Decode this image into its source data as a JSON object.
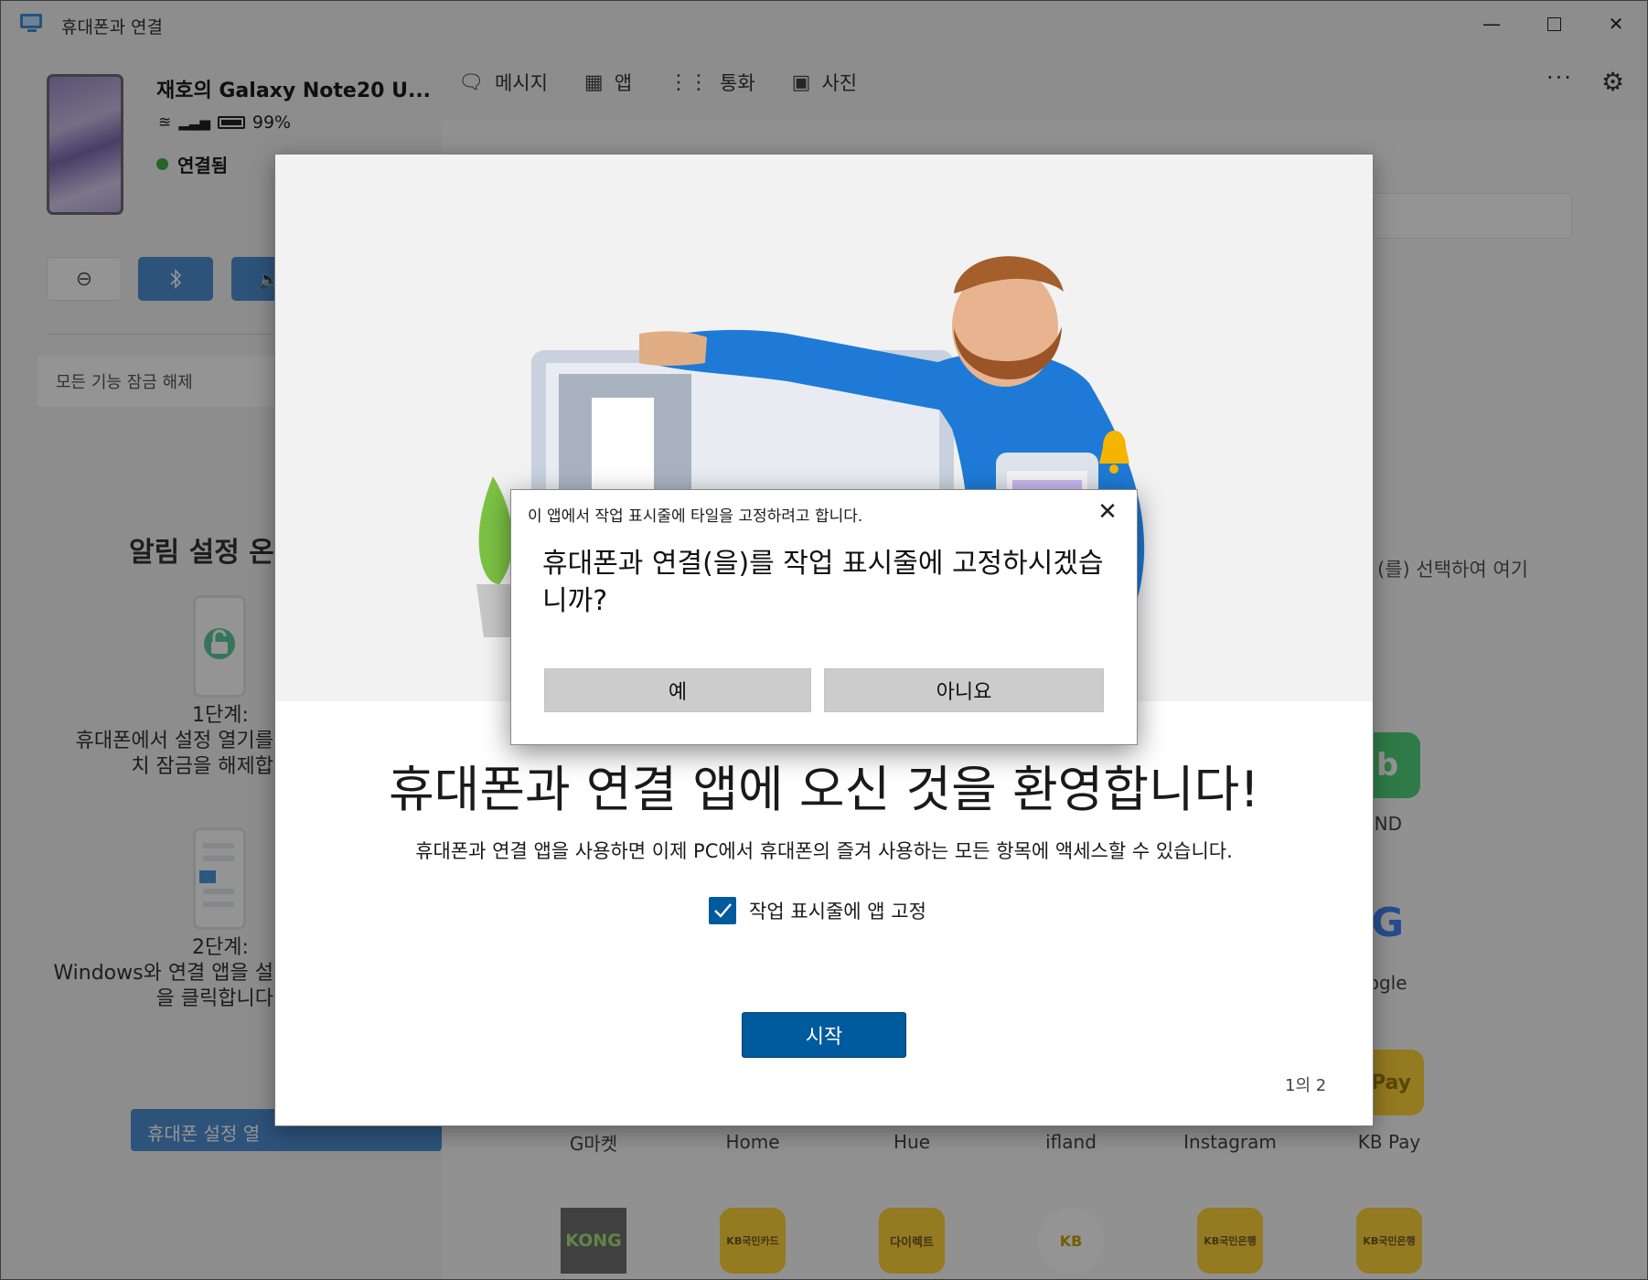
{
  "window": {
    "title": "휴대폰과 연결",
    "minimize_icon": "minimize-icon",
    "maximize_icon": "maximize-icon",
    "close_icon": "close-icon"
  },
  "device": {
    "name": "재호의 Galaxy Note20 U...",
    "battery": "99%",
    "status": "연결됨",
    "status_color": "#3cb045"
  },
  "quick_actions": {
    "dnd_icon": "minus-circle-icon",
    "bluetooth_icon": "bluetooth-icon",
    "audio_icon": "speaker-icon",
    "accent": "#4f8fd4"
  },
  "sidebar": {
    "unlock_placeholder": "모든 기능 잠금 해제",
    "notif_title": "알림 설정 온",
    "step1_label": "1단계:",
    "step1_text1": "휴대폰에서 설정 열기를",
    "step1_text2": "치 잠금을 해제합",
    "step2_label": "2단계:",
    "step2_text1": "Windows와 연결 앱을 설",
    "step2_text2": "을 클릭합니다",
    "settings_button": "휴대폰 설정 열"
  },
  "nav": {
    "items": [
      {
        "label": "메시지",
        "icon": "message-icon"
      },
      {
        "label": "앱",
        "icon": "apps-icon"
      },
      {
        "label": "통화",
        "icon": "dialpad-icon"
      },
      {
        "label": "사진",
        "icon": "photo-icon"
      }
    ],
    "more": "···",
    "settings_icon": "gear-icon"
  },
  "content": {
    "hint": "(를) 선택하여 여기",
    "side_apps": [
      "AND",
      "oogle",
      "KB Pay"
    ],
    "apps_row": [
      "G마켓",
      "Home",
      "Hue",
      "ifland",
      "Instagram",
      "KB Pay"
    ],
    "bottom_tiles": [
      "KONG",
      "KB국민카드",
      "다이렉트",
      "KB",
      "KB국민은행",
      "KB국민은행"
    ]
  },
  "welcome": {
    "heading": "휴대폰과 연결 앱에 오신 것을 환영합니다!",
    "subtext": "휴대폰과 연결 앱을 사용하면 이제 PC에서 휴대폰의 즐겨 사용하는 모든 항목에 액세스할 수 있습니다.",
    "pin_checkbox_label": "작업 표시줄에 앱 고정",
    "pin_checked": true,
    "start_button": "시작",
    "pager": "1의 2",
    "accent": "#005a9e"
  },
  "confirm": {
    "caption": "이 앱에서 작업 표시줄에 타일을 고정하려고 합니다.",
    "question": "휴대폰과 연결(을)를 작업 표시줄에 고정하시겠습니까?",
    "yes": "예",
    "no": "아니요"
  }
}
